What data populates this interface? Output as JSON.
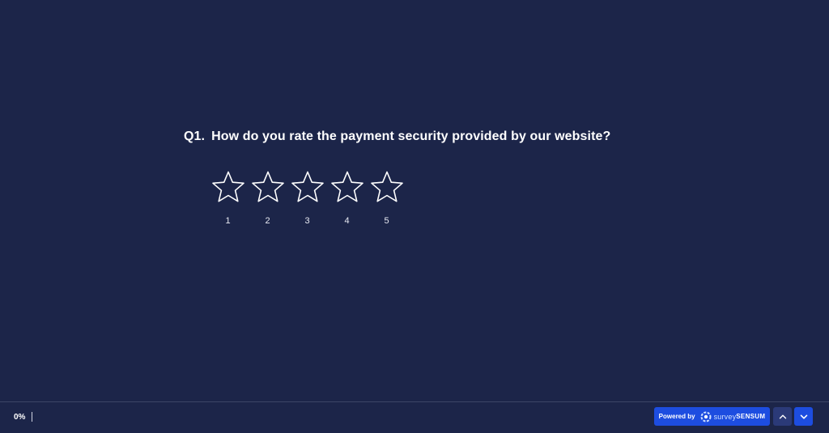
{
  "question": {
    "number": "Q1.",
    "text": "How do you rate the payment security provided by our website?"
  },
  "rating": {
    "icon": "star-outline-icon",
    "options": [
      {
        "label": "1"
      },
      {
        "label": "2"
      },
      {
        "label": "3"
      },
      {
        "label": "4"
      },
      {
        "label": "5"
      }
    ]
  },
  "footer": {
    "progress": "0%",
    "powered_by": "Powered by",
    "brand_part1": "survey",
    "brand_part2": "SENSUM",
    "nav_up_icon": "chevron-up-icon",
    "nav_down_icon": "chevron-down-icon"
  },
  "colors": {
    "background": "#1c2549",
    "accent": "#1d4de0",
    "nav_up": "#2b3a78",
    "text": "#ffffff"
  }
}
